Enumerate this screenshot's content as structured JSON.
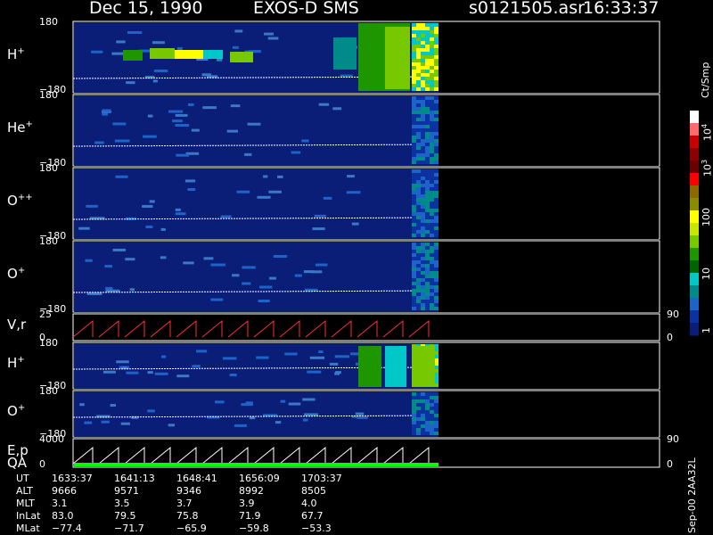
{
  "header": {
    "date": "Dec 15, 1990",
    "mission": "EXOS-D SMS",
    "file": "s0121505.asr",
    "time": "16:33:37"
  },
  "panels": [
    {
      "label": "H",
      "sup": "+",
      "top_tick": "180",
      "bottom_tick": "−180"
    },
    {
      "label": "He",
      "sup": "+",
      "top_tick": "180",
      "bottom_tick": "−180"
    },
    {
      "label": "O",
      "sup": "++",
      "top_tick": "180",
      "bottom_tick": "−180"
    },
    {
      "label": "O",
      "sup": "+",
      "top_tick": "180",
      "bottom_tick": "−180"
    },
    {
      "label": "V,r",
      "sup": "",
      "top_tick": "25",
      "bottom_tick": "0",
      "right_top": "90",
      "right_bottom": "0"
    },
    {
      "label": "H",
      "sup": "+",
      "top_tick": "180",
      "bottom_tick": "−180"
    },
    {
      "label": "O",
      "sup": "+",
      "top_tick": "180",
      "bottom_tick": "−180"
    },
    {
      "label": "E,p",
      "label2": "QA",
      "sup": "",
      "top_tick": "4000",
      "bottom_tick": "0",
      "right_top": "90",
      "right_bottom": "0"
    }
  ],
  "colorbar": {
    "unit": "Ct/Smp",
    "ticks": [
      "10",
      "10",
      "100",
      "10",
      "1"
    ],
    "tick_sups": [
      "4",
      "3",
      "",
      "",
      ""
    ],
    "colors": [
      "#ffffff",
      "#ff6b6b",
      "#c80000",
      "#8b0000",
      "#6b0000",
      "#ff0000",
      "#8b6b00",
      "#8b8b00",
      "#ffff00",
      "#c8e600",
      "#78c800",
      "#1e9600",
      "#006400",
      "#00c8c8",
      "#008b8b",
      "#1e64c8",
      "#0a32a0",
      "#0a1e78"
    ]
  },
  "footer": {
    "rows": [
      {
        "label": "UT",
        "values": [
          "1633:37",
          "1641:13",
          "1648:41",
          "1656:09",
          "1703:37"
        ]
      },
      {
        "label": "ALT",
        "values": [
          "9666",
          "9571",
          "9346",
          "8992",
          "8505"
        ]
      },
      {
        "label": "MLT",
        "values": [
          "3.1",
          "3.5",
          "3.7",
          "3.9",
          "4.0"
        ]
      },
      {
        "label": "InLat",
        "values": [
          "83.0",
          "79.5",
          "75.8",
          "71.9",
          "67.7"
        ]
      },
      {
        "label": "MLat",
        "values": [
          "−77.4",
          "−71.7",
          "−65.9",
          "−59.8",
          "−53.3"
        ]
      }
    ],
    "side_label": "Sep-00  2AA32L"
  },
  "chart_data": {
    "type": "heatmap",
    "x_ticks_ut": [
      "1633:37",
      "1641:13",
      "1648:41",
      "1656:09",
      "1703:37"
    ],
    "panels": [
      "H+",
      "He+",
      "O++",
      "O+",
      "V,r",
      "H+",
      "O+",
      "E,p QA"
    ],
    "colorbar_range": [
      1,
      10000
    ],
    "colorbar_scale": "log"
  }
}
